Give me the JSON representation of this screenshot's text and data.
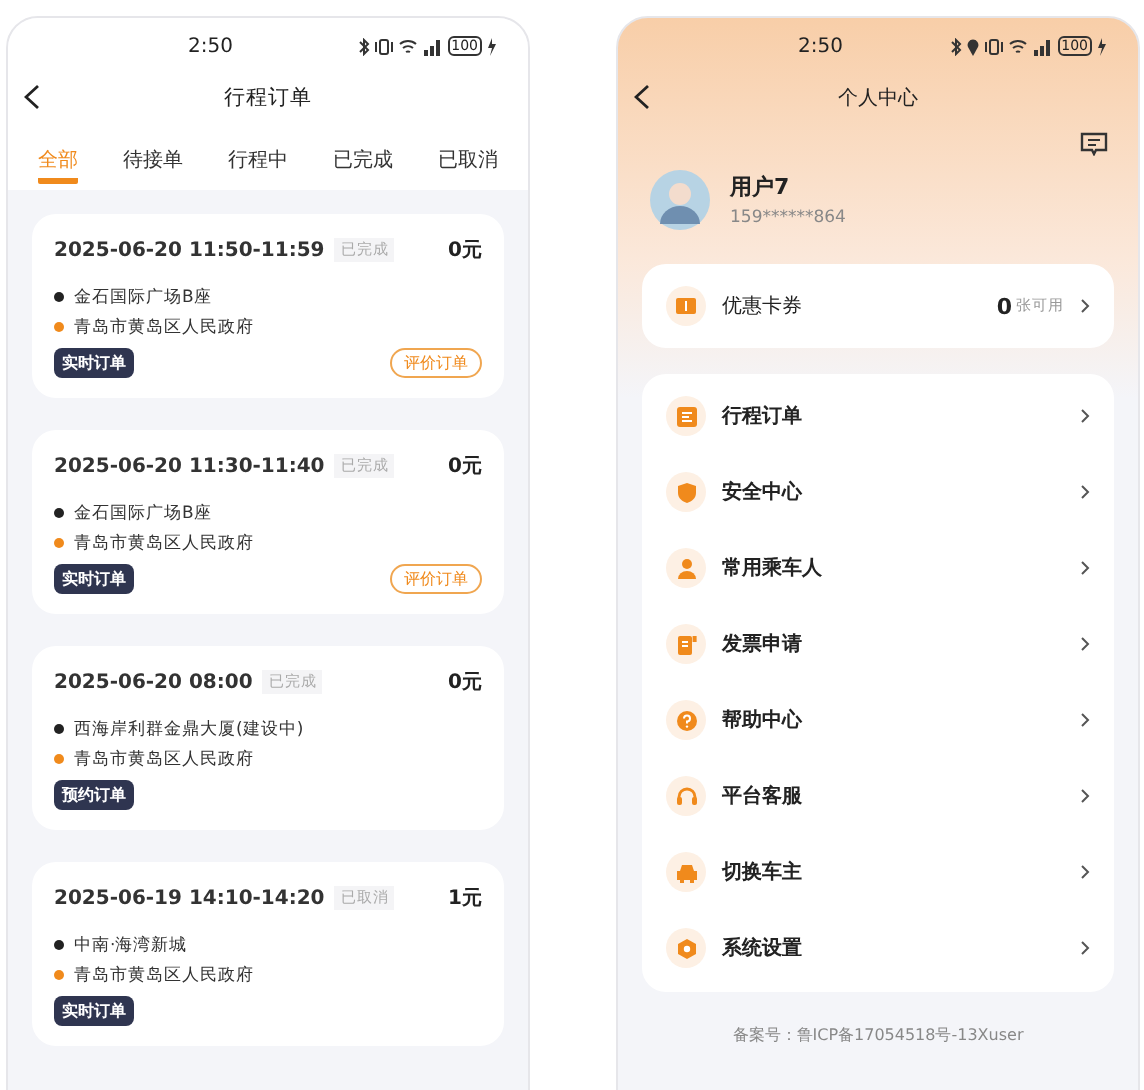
{
  "orders_screen": {
    "status_bar": {
      "time": "2:50",
      "battery": "100"
    },
    "title": "行程订单",
    "tabs": [
      {
        "label": "全部",
        "selected": true
      },
      {
        "label": "待接单",
        "selected": false
      },
      {
        "label": "行程中",
        "selected": false
      },
      {
        "label": "已完成",
        "selected": false
      },
      {
        "label": "已取消",
        "selected": false
      }
    ],
    "orders": [
      {
        "time": "2025-06-20 11:50-11:59",
        "status": "已完成",
        "price": "0元",
        "stops": [
          {
            "kind": "from",
            "name": "金石国际广场B座"
          },
          {
            "kind": "to",
            "name": "青岛市黄岛区人民政府"
          }
        ],
        "type": "实时订单",
        "action": "评价订单"
      },
      {
        "time": "2025-06-20 11:30-11:40",
        "status": "已完成",
        "price": "0元",
        "stops": [
          {
            "kind": "from",
            "name": "金石国际广场B座"
          },
          {
            "kind": "to",
            "name": "青岛市黄岛区人民政府"
          }
        ],
        "type": "实时订单",
        "action": "评价订单"
      },
      {
        "time": "2025-06-20 08:00",
        "status": "已完成",
        "price": "0元",
        "stops": [
          {
            "kind": "from",
            "name": "西海岸利群金鼎大厦(建设中)"
          },
          {
            "kind": "to",
            "name": "青岛市黄岛区人民政府"
          }
        ],
        "type": "预约订单"
      },
      {
        "time": "2025-06-19 14:10-14:20",
        "status": "已取消",
        "price": "1元",
        "stops": [
          {
            "kind": "from",
            "name": "中南·海湾新城"
          },
          {
            "kind": "to",
            "name": "青岛市黄岛区人民政府"
          }
        ],
        "type": "实时订单"
      }
    ]
  },
  "profile_screen": {
    "status_bar": {
      "time": "2:50",
      "battery": "100",
      "location": true
    },
    "title": "个人中心",
    "user": {
      "name": "用户7",
      "phone": "159******864"
    },
    "coupons": {
      "label": "优惠卡券",
      "count": "0",
      "unit": "张可用"
    },
    "menu": [
      {
        "kind": "orders",
        "label": "行程订单"
      },
      {
        "kind": "safety",
        "label": "安全中心"
      },
      {
        "kind": "passenger",
        "label": "常用乘车人"
      },
      {
        "kind": "invoice",
        "label": "发票申请"
      },
      {
        "kind": "help",
        "label": "帮助中心"
      },
      {
        "kind": "service",
        "label": "平台客服"
      },
      {
        "kind": "car",
        "label": "切换车主"
      },
      {
        "kind": "settings",
        "label": "系统设置"
      }
    ],
    "footer": "备案号：鲁ICP备17054518号-13Xuser"
  }
}
